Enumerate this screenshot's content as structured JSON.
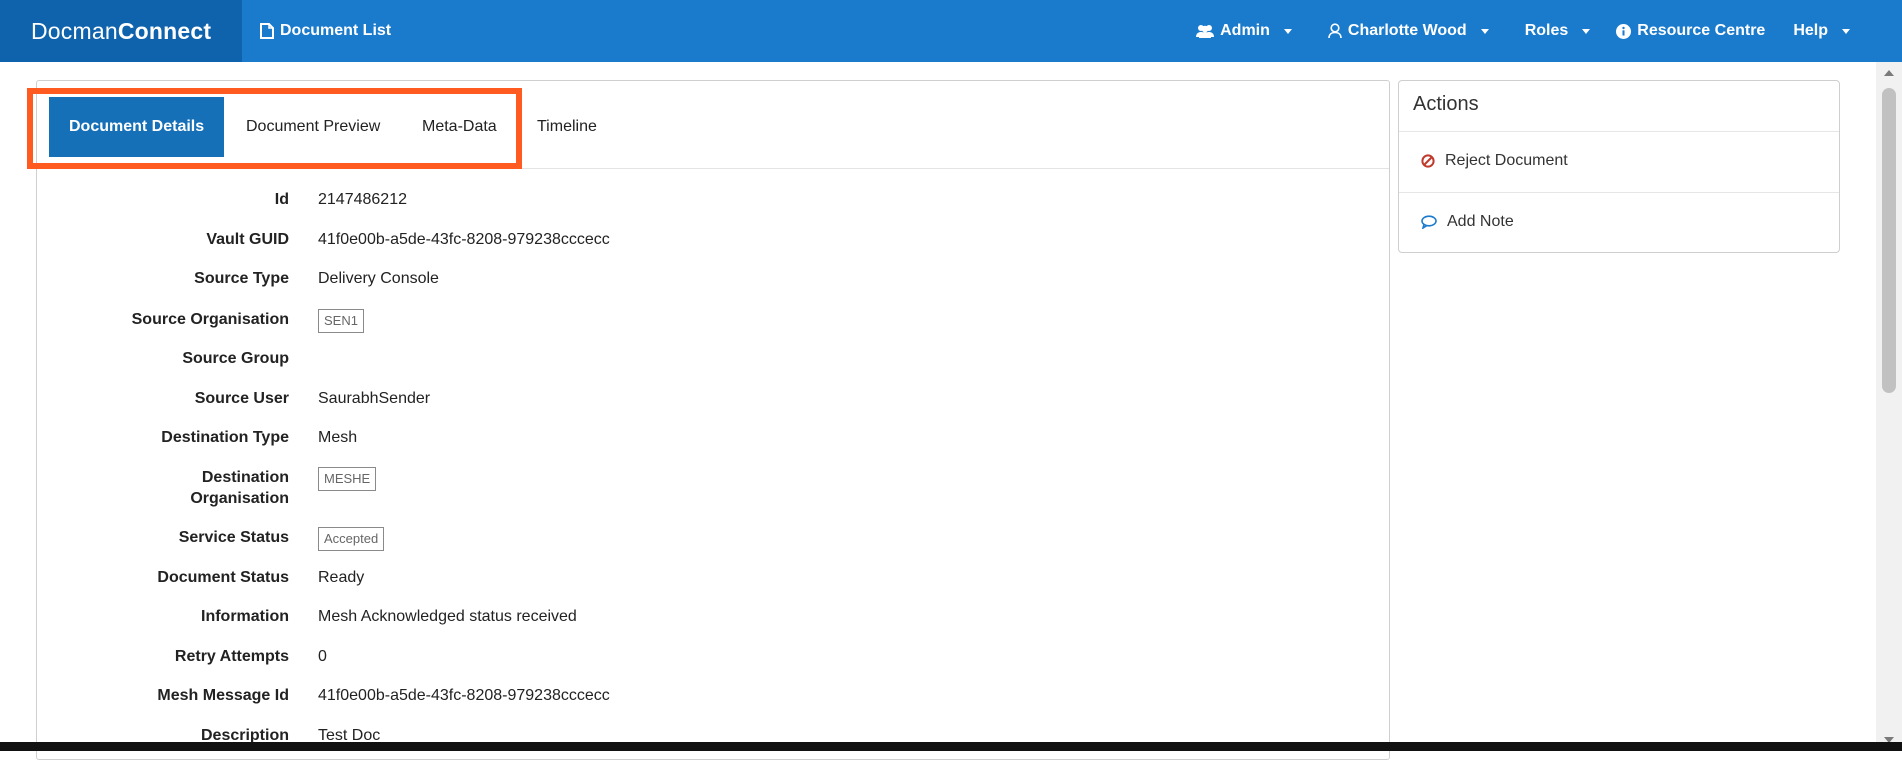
{
  "brand": {
    "prefix": "Docman",
    "suffix": "Connect"
  },
  "nav": {
    "document_list": "Document List",
    "admin": "Admin",
    "user": "Charlotte Wood",
    "roles": "Roles",
    "resource_centre": "Resource Centre",
    "help": "Help"
  },
  "tabs": [
    "Document Details",
    "Document Preview",
    "Meta-Data",
    "Timeline"
  ],
  "details": [
    {
      "label": "Id",
      "value": "2147486212",
      "tag": false
    },
    {
      "label": "Vault GUID",
      "value": "41f0e00b-a5de-43fc-8208-979238cccecc",
      "tag": false
    },
    {
      "label": "Source Type",
      "value": "Delivery Console",
      "tag": false
    },
    {
      "label": "Source Organisation",
      "value": "SEN1",
      "tag": true
    },
    {
      "label": "Source Group",
      "value": "",
      "tag": false
    },
    {
      "label": "Source User",
      "value": "SaurabhSender",
      "tag": false
    },
    {
      "label": "Destination Type",
      "value": "Mesh",
      "tag": false
    },
    {
      "label": "Destination Organisation",
      "label_line1": "Destination",
      "label_line2": "Organisation",
      "value": "MESHE",
      "tag": true
    },
    {
      "label": "Service Status",
      "value": "Accepted",
      "tag": true
    },
    {
      "label": "Document Status",
      "value": "Ready",
      "tag": false
    },
    {
      "label": "Information",
      "value": "Mesh Acknowledged status received",
      "tag": false
    },
    {
      "label": "Retry Attempts",
      "value": "0",
      "tag": false
    },
    {
      "label": "Mesh Message Id",
      "value": "41f0e00b-a5de-43fc-8208-979238cccecc",
      "tag": false
    },
    {
      "label": "Description",
      "value": "Test Doc",
      "tag": false
    }
  ],
  "actions": {
    "title": "Actions",
    "reject": "Reject Document",
    "add_note": "Add Note"
  },
  "colors": {
    "navbar": "#1a7acc",
    "brand_bg": "#0f63ad",
    "active_tab": "#1570b8",
    "highlight": "#ff5a1f",
    "reject_icon": "#c0392b",
    "note_icon": "#1a7acc"
  }
}
